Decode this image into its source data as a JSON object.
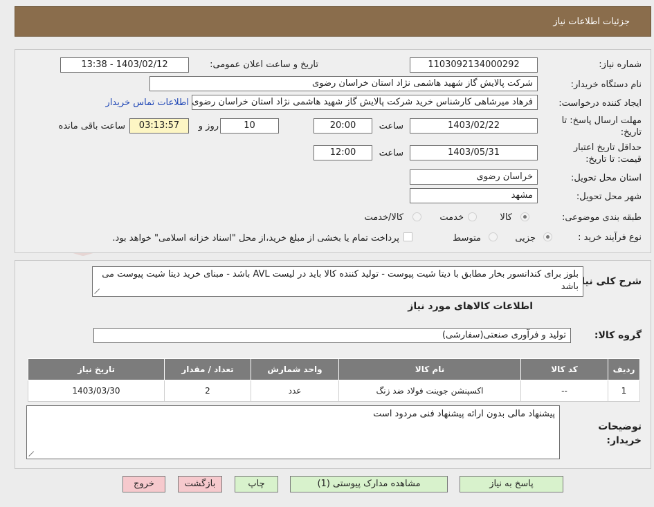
{
  "header": {
    "title": "جزئیات اطلاعات نیاز"
  },
  "watermark": {
    "text": "AriaTender.net"
  },
  "form": {
    "need_number_label": "شماره نیاز:",
    "need_number": "1103092134000292",
    "announce_label": "تاریخ و ساعت اعلان عمومی:",
    "announce_value": "1403/02/12 - 13:38",
    "buyer_org_label": "نام دستگاه خریدار:",
    "buyer_org": "شرکت پالایش گاز شهید هاشمی نژاد   استان خراسان رضوی",
    "requester_label": "ایجاد کننده درخواست:",
    "requester": "فرهاد میرشاهی کارشناس خرید شرکت پالایش گاز شهید هاشمی نژاد   استان خراسان رضوی",
    "contact_link": "اطلاعات تماس خریدار",
    "deadline_label": "مهلت ارسال پاسخ: تا تاریخ:",
    "deadline_date": "1403/02/22",
    "time_label": "ساعت",
    "deadline_time": "20:00",
    "days_value": "10",
    "day_and_label": "روز و",
    "remaining_time": "03:13:57",
    "remaining_label": "ساعت باقی مانده",
    "validity_label": "حداقل تاریخ اعتبار قیمت: تا تاریخ:",
    "validity_date": "1403/05/31",
    "validity_time_label": "ساعت",
    "validity_time": "12:00",
    "province_label": "استان محل تحویل:",
    "province": "خراسان رضوی",
    "city_label": "شهر محل تحویل:",
    "city": "مشهد",
    "category_label": "طبقه بندی موضوعی:",
    "category_options": [
      "کالا",
      "خدمت",
      "کالا/خدمت"
    ],
    "process_label": "نوع فرآیند خرید :",
    "process_options": [
      "جزیی",
      "متوسط"
    ],
    "payment_note": "پرداخت تمام یا بخشی از مبلغ خرید،از محل \"اسناد خزانه اسلامی\" خواهد بود."
  },
  "details": {
    "description_label": "شرح کلی نیاز:",
    "description": "بلوز برای کندانسور بخار مطابق با دیتا شیت پیوست - تولید کننده کالا باید در لیست AVL باشد - مبنای خرید دیتا شیت پیوست می باشد",
    "goods_info_title": "اطلاعات کالاهای مورد نیاز",
    "goods_group_label": "گروه کالا:",
    "goods_group": "تولید و فرآوری صنعتی(سفارشی)",
    "table": {
      "headers": [
        "ردیف",
        "کد کالا",
        "نام کالا",
        "واحد شمارش",
        "تعداد / مقدار",
        "تاریخ نیاز"
      ],
      "rows": [
        [
          "1",
          "--",
          "اکسپنشن جوینت فولاد ضد زنگ",
          "عدد",
          "2",
          "1403/03/30"
        ]
      ]
    },
    "buyer_notes_label": "توضیحات خریدار:",
    "buyer_notes": "پیشنهاد مالی بدون ارائه پیشنهاد فنی مردود است"
  },
  "buttons": {
    "reply": "پاسخ به نیاز",
    "attachments": "مشاهده مدارک پیوستی (1)",
    "print": "چاپ",
    "back": "بازگشت",
    "exit": "خروج"
  },
  "colors": {
    "header_bg": "#8a6d4c",
    "table_header_bg": "#7c7c7c",
    "green_button": "#d8f2cc",
    "pink_button": "#f6c9cd",
    "timer_bg": "#fdf6c4",
    "link": "#1d45b5"
  }
}
